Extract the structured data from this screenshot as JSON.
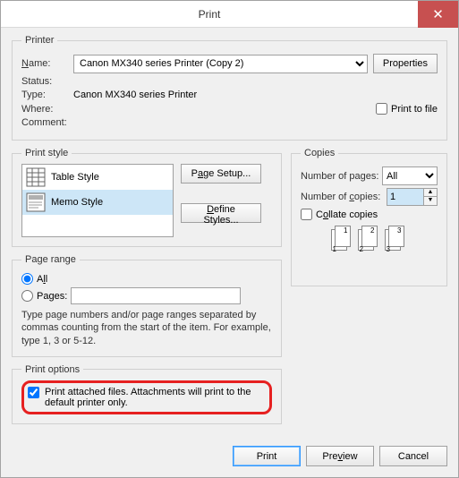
{
  "title": "Print",
  "printer": {
    "legend": "Printer",
    "name_label": "Name:",
    "name_value": "Canon MX340 series Printer (Copy 2)",
    "properties_btn": "Properties",
    "status_label": "Status:",
    "status_value": "",
    "type_label": "Type:",
    "type_value": "Canon MX340 series Printer",
    "where_label": "Where:",
    "where_value": "",
    "comment_label": "Comment:",
    "comment_value": "",
    "print_to_file": "Print to file"
  },
  "printstyle": {
    "legend": "Print style",
    "items": [
      "Table Style",
      "Memo Style"
    ],
    "page_setup_btn": "Page Setup...",
    "define_styles_btn": "Define Styles..."
  },
  "copies": {
    "legend": "Copies",
    "num_pages_label": "Number of pages:",
    "num_pages_value": "All",
    "num_copies_label": "Number of copies:",
    "num_copies_value": "1",
    "collate_label": "Collate copies"
  },
  "pagerange": {
    "legend": "Page range",
    "all_label": "All",
    "pages_label": "Pages:",
    "help": "Type page numbers and/or page ranges separated by commas counting from the start of the item.  For example, type 1, 3 or 5-12."
  },
  "printoptions": {
    "legend": "Print options",
    "attach_label": "Print attached files.  Attachments will print to the default printer only."
  },
  "footer": {
    "print": "Print",
    "preview": "Preview",
    "cancel": "Cancel"
  }
}
